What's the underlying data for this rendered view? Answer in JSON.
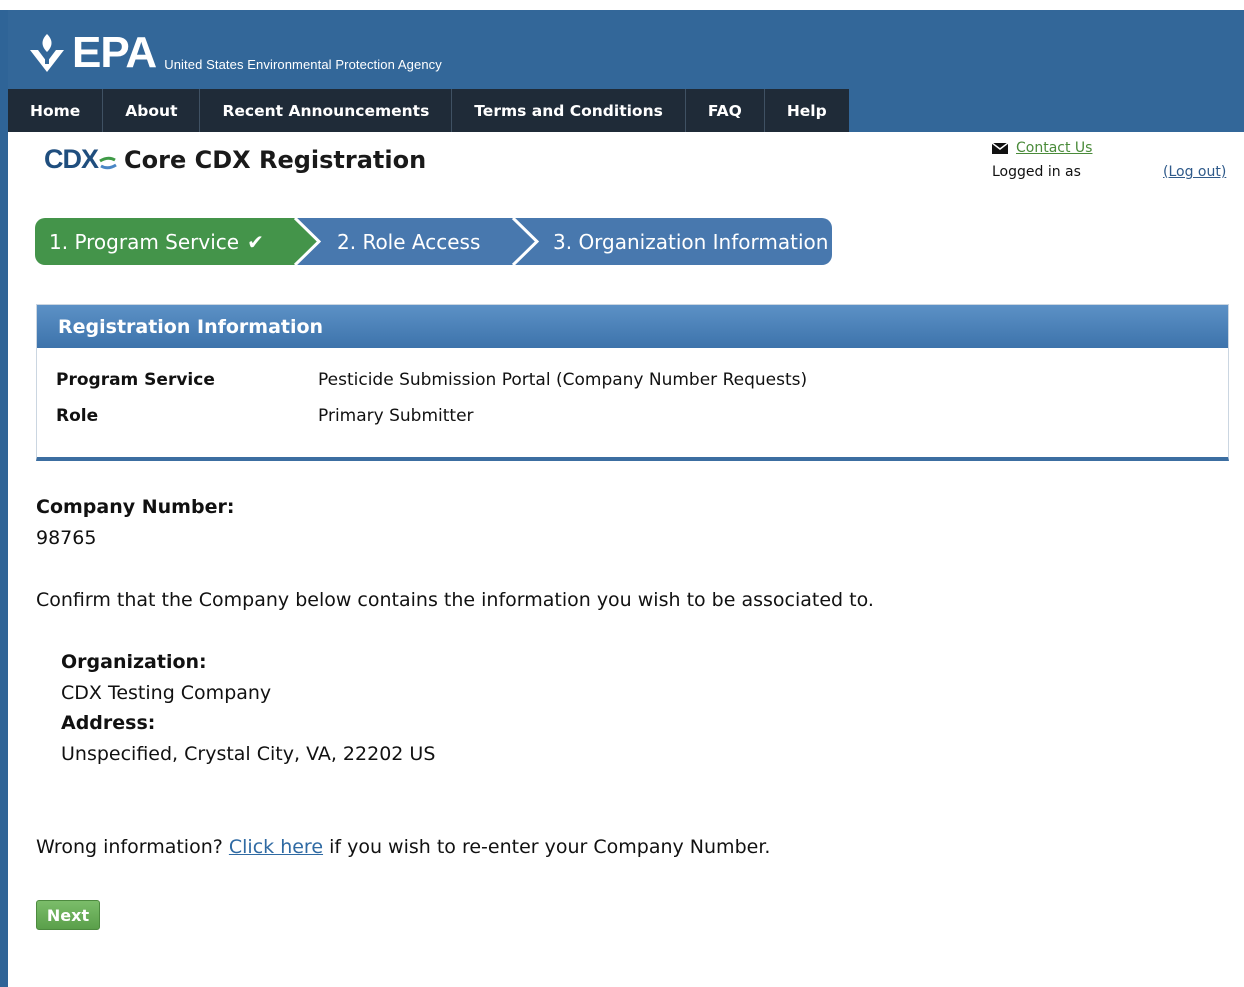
{
  "brand": {
    "logo_text": "EPA",
    "agency": "United States Environmental Protection Agency",
    "header_color": "#336799"
  },
  "nav": {
    "items": [
      {
        "label": "Home"
      },
      {
        "label": "About"
      },
      {
        "label": "Recent Announcements"
      },
      {
        "label": "Terms and Conditions"
      },
      {
        "label": "FAQ"
      },
      {
        "label": "Help"
      }
    ]
  },
  "app": {
    "logo_text": "CDX",
    "title": "Core CDX Registration"
  },
  "account": {
    "contact_label": "Contact Us",
    "logged_in_label": "Logged in as",
    "logout_label": "(Log out)"
  },
  "steps": [
    {
      "label": "1. Program Service",
      "status": "complete",
      "color": "#44944a"
    },
    {
      "label": "2. Role Access",
      "status": "pending",
      "color": "#4878ae"
    },
    {
      "label": "3. Organization Information",
      "status": "current",
      "color": "#4878ae"
    }
  ],
  "registration": {
    "heading": "Registration Information",
    "program_service_label": "Program Service",
    "program_service_value": "Pesticide Submission Portal (Company Number Requests)",
    "role_label": "Role",
    "role_value": "Primary Submitter"
  },
  "company": {
    "number_label": "Company Number:",
    "number_value": "98765",
    "confirm_text": "Confirm that the Company below contains the information you wish to be associated to.",
    "organization_label": "Organization:",
    "organization_value": "CDX Testing Company",
    "address_label": "Address:",
    "address_value": "Unspecified, Crystal City, VA, 22202 US"
  },
  "wrong_info": {
    "prefix": "Wrong information?",
    "link_label": "Click here",
    "suffix": "if you wish to re-enter your Company Number."
  },
  "actions": {
    "next_label": "Next"
  }
}
